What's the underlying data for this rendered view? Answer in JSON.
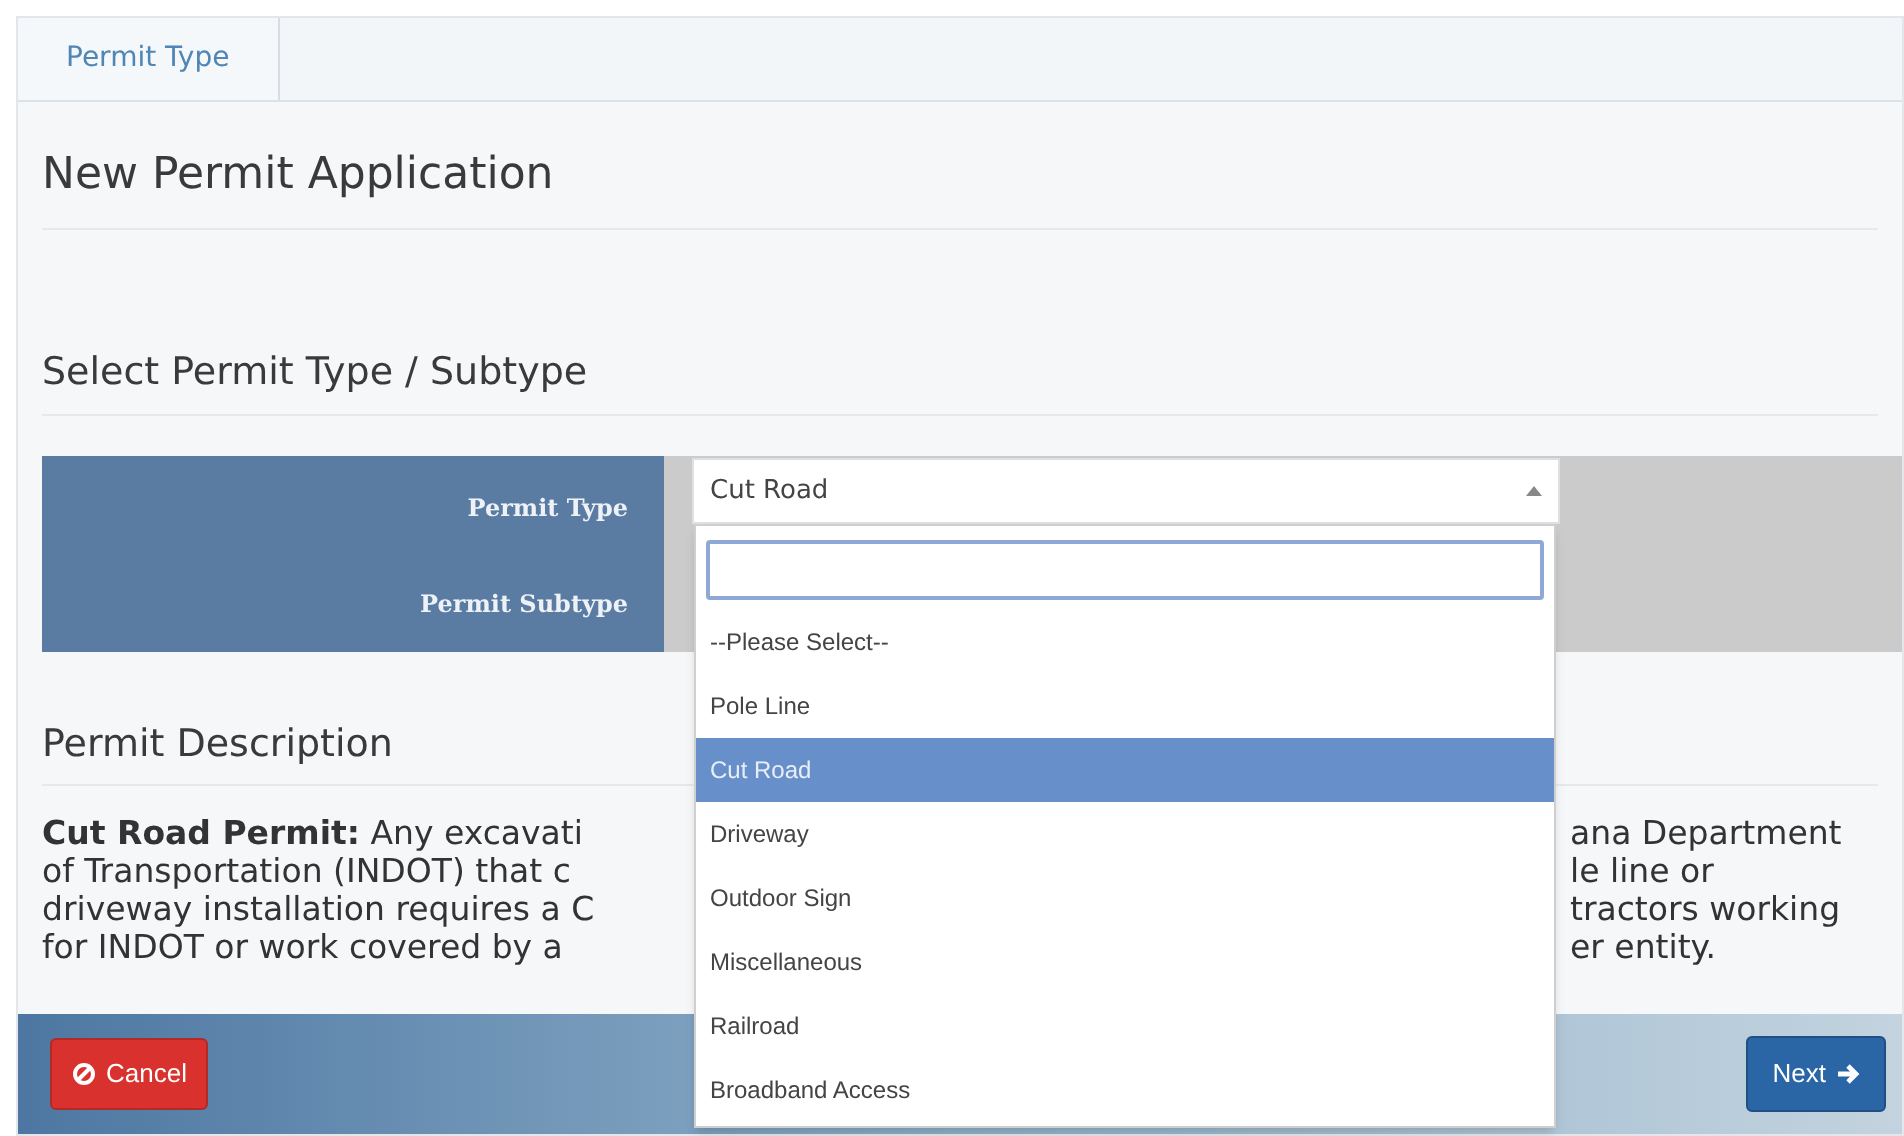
{
  "breadcrumb": [
    {
      "label": "Permit Type",
      "selected": true
    }
  ],
  "title": "New Permit Application",
  "section_title": "Select Permit Type / Subtype",
  "form": {
    "fields": [
      {
        "label": "Permit Type"
      },
      {
        "label": "Permit Subtype"
      }
    ],
    "permit_type_select": {
      "value": "Cut Road",
      "expanded": true,
      "options": [
        {
          "label": "--Please Select--",
          "selected": false
        },
        {
          "label": "Pole Line",
          "selected": false
        },
        {
          "label": "Cut Road",
          "selected": true
        },
        {
          "label": "Driveway",
          "selected": false
        },
        {
          "label": "Outdoor Sign",
          "selected": false
        },
        {
          "label": "Miscellaneous",
          "selected": false
        },
        {
          "label": "Railroad",
          "selected": false
        },
        {
          "label": "Broadband Access",
          "selected": false
        }
      ]
    }
  },
  "description_title": "Permit Description",
  "description_lines": [
    {
      "left": "**Cut Road Permit:** Any excavati",
      "right": "ana Department"
    },
    {
      "left": "of Transportation (INDOT) that c",
      "right": "le line or"
    },
    {
      "left": "driveway installation requires a C",
      "right": "tractors working"
    },
    {
      "left": "for INDOT or work covered by a",
      "right": "er entity."
    }
  ],
  "buttons": [
    {
      "label": "Cancel",
      "kind": "cancel"
    },
    {
      "label": "Next",
      "kind": "next"
    }
  ]
}
